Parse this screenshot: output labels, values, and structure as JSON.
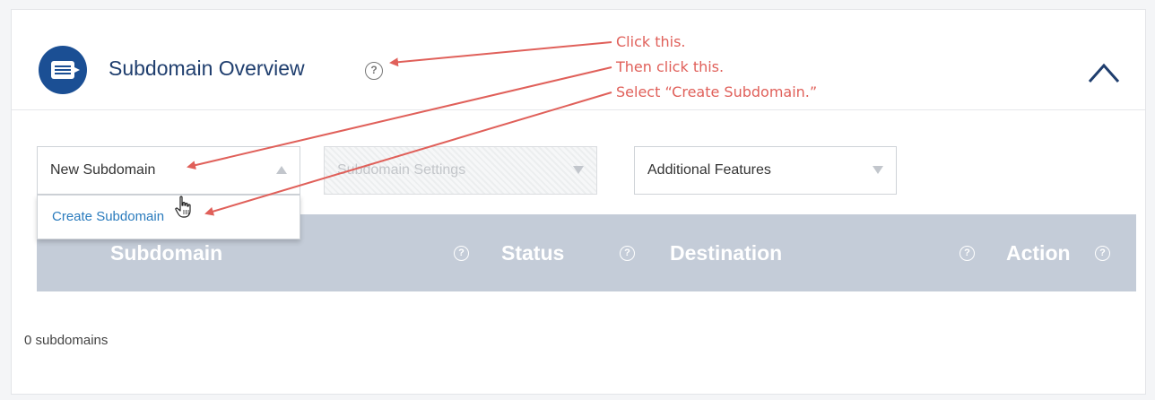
{
  "panel": {
    "title": "Subdomain Overview",
    "help_symbol": "?",
    "collapse_icon": "chevron-up-icon",
    "accent_color": "#1b4f94"
  },
  "toolbar": {
    "new_subdomain": "New Subdomain",
    "subdomain_settings": "Subdomain Settings",
    "additional_features": "Additional Features"
  },
  "menu": {
    "create_subdomain": "Create Subdomain"
  },
  "table": {
    "columns": [
      {
        "label": "Subdomain"
      },
      {
        "label": "Status"
      },
      {
        "label": "Destination"
      },
      {
        "label": "Action"
      }
    ],
    "header_color": "#c4ccd8",
    "help_symbol": "?"
  },
  "footer": {
    "count_text": "0 subdomains"
  },
  "annotations": {
    "step1": "Click this.",
    "step2": "Then click this.",
    "step3": "Select “Create Subdomain.”",
    "color": "#e0605a"
  }
}
